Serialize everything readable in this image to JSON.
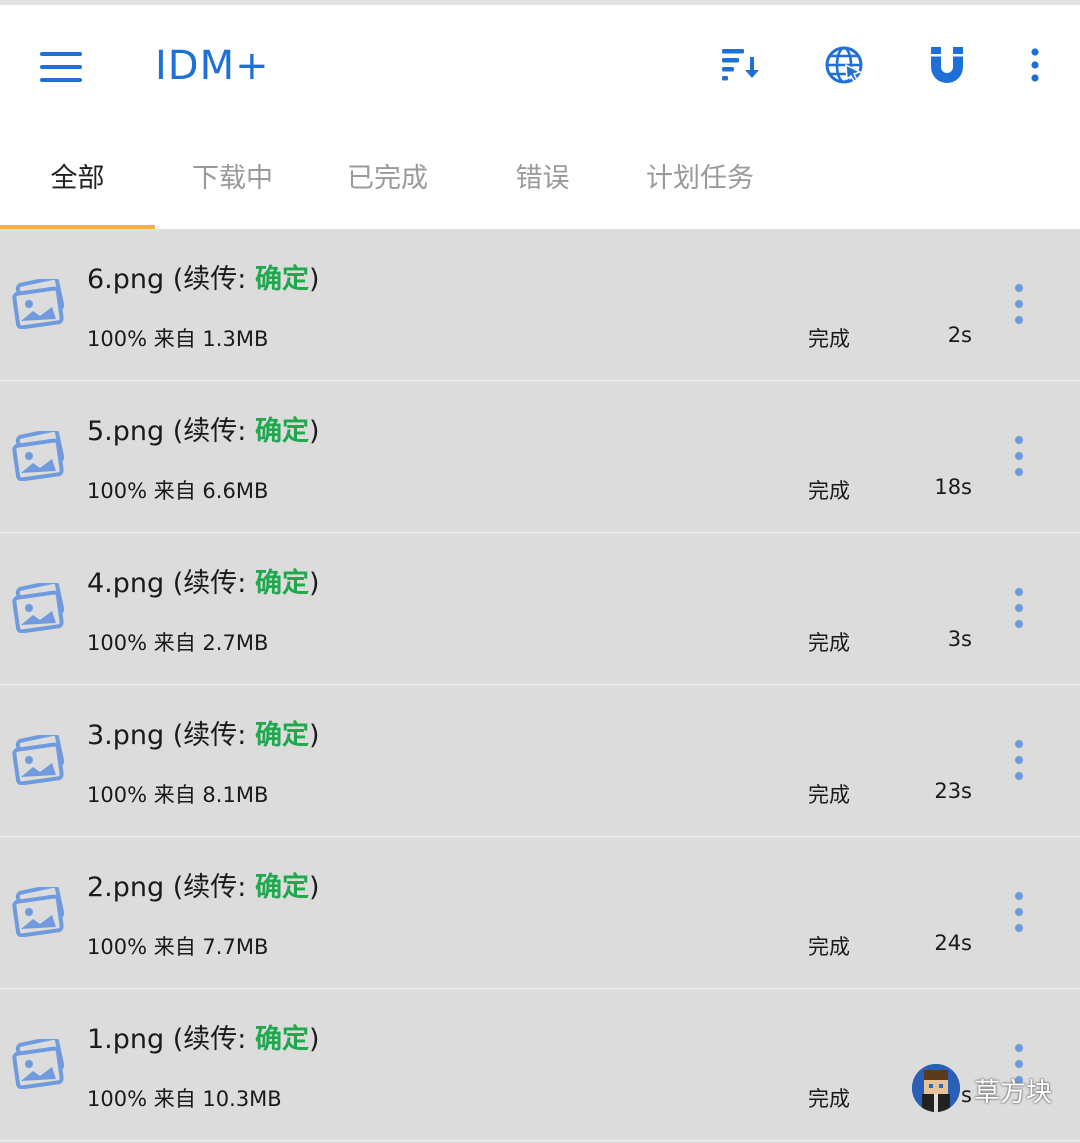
{
  "app": {
    "title": "IDM+",
    "accent_color": "#1e6fd8",
    "tab_indicator_color": "#f6b33c"
  },
  "toolbar": {
    "menu_icon": "hamburger-icon",
    "actions": [
      {
        "icon": "sort-icon"
      },
      {
        "icon": "globe-icon"
      },
      {
        "icon": "magnet-icon"
      },
      {
        "icon": "more-vert-icon"
      }
    ]
  },
  "tabs": [
    {
      "label": "全部",
      "active": true
    },
    {
      "label": "下载中"
    },
    {
      "label": "已完成"
    },
    {
      "label": "错误"
    },
    {
      "label": "计划任务"
    }
  ],
  "downloads": [
    {
      "file": "6.png",
      "resume_prefix": " (续传: ",
      "resume_value": "确定",
      "resume_suffix": ")",
      "progress": "100%",
      "from_label": "来自",
      "size": "1.3MB",
      "status": "完成",
      "time": "2s"
    },
    {
      "file": "5.png",
      "resume_prefix": " (续传: ",
      "resume_value": "确定",
      "resume_suffix": ")",
      "progress": "100%",
      "from_label": "来自",
      "size": "6.6MB",
      "status": "完成",
      "time": "18s"
    },
    {
      "file": "4.png",
      "resume_prefix": " (续传: ",
      "resume_value": "确定",
      "resume_suffix": ")",
      "progress": "100%",
      "from_label": "来自",
      "size": "2.7MB",
      "status": "完成",
      "time": "3s"
    },
    {
      "file": "3.png",
      "resume_prefix": " (续传: ",
      "resume_value": "确定",
      "resume_suffix": ")",
      "progress": "100%",
      "from_label": "来自",
      "size": "8.1MB",
      "status": "完成",
      "time": "23s"
    },
    {
      "file": "2.png",
      "resume_prefix": " (续传: ",
      "resume_value": "确定",
      "resume_suffix": ")",
      "progress": "100%",
      "from_label": "来自",
      "size": "7.7MB",
      "status": "完成",
      "time": "24s"
    },
    {
      "file": "1.png",
      "resume_prefix": " (续传: ",
      "resume_value": "确定",
      "resume_suffix": ")",
      "progress": "100%",
      "from_label": "来自",
      "size": "10.3MB",
      "status": "完成",
      "time": "s"
    }
  ],
  "status_color_ok": "#1fa84e",
  "watermark": {
    "text": "草方块"
  }
}
